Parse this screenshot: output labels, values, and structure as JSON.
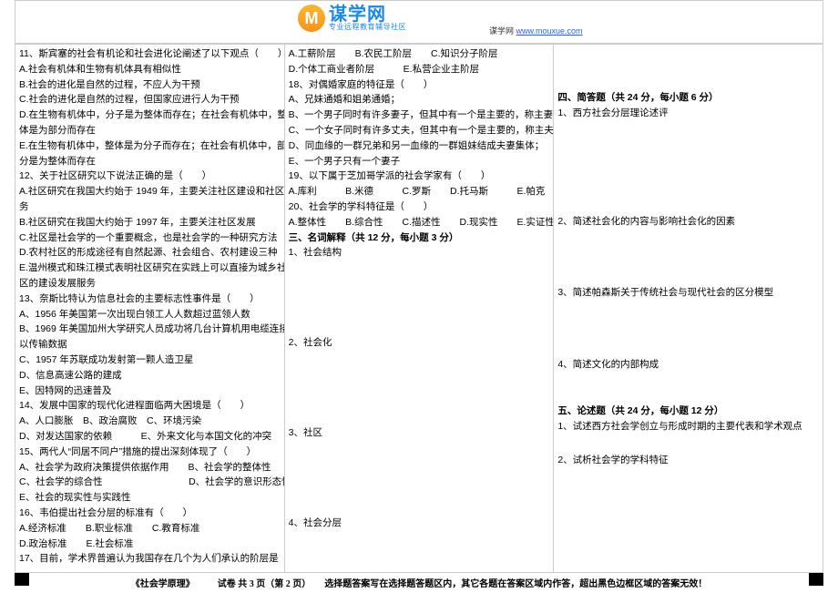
{
  "logo": {
    "main": "谋学网",
    "sub": "专业远程教育辅导社区",
    "mark": "M"
  },
  "site": {
    "pre": "谋学网 ",
    "url": "www.mouxue.com"
  },
  "col1": [
    "11、斯宾塞的社会有机论和社会进化论阐述了以下观点（　　）",
    "A.社会有机体和生物有机体具有相似性",
    "B.社会的进化是自然的过程，不应人为干预",
    "C.社会的进化是自然的过程，但国家应进行人为干预",
    "D.在生物有机体中，分子是为整体而存在；在社会有机体中，整",
    "体是为部分而存在",
    "E.在生物有机体中，整体是为分子而存在；在社会有机体中，部",
    "分是为整体而存在",
    "12、关于社区研究以下说法正确的是（　　）",
    "A.社区研究在我国大约始于 1949 年，主要关注社区建设和社区服",
    "务",
    "B.社区研究在我国大约始于 1997 年，主要关注社区发展",
    "C.社区是社会学的一个重要概念，也是社会学的一种研究方法",
    "D.农村社区的形成途径有自然起源、社会组合、农村建设三种",
    "E.温州模式和珠江模式表明社区研究在实践上可以直接为城乡社",
    "区的建设发展服务",
    "13、奈斯比特认为信息社会的主要标志性事件是（　　）",
    "A、1956 年美国第一次出现白领工人人数超过蓝领人数",
    "B、1969 年美国加州大学研究人员成功将几台计算机用电缆连接",
    "以传输数据",
    "C、1957 年苏联成功发射第一颗人造卫星",
    "D、信息高速公路的建成",
    "E、因特网的迅速普及",
    "14、发展中国家的现代化进程面临两大困境是（　　）",
    "A、人口膨胀　B、政治腐败　C、环境污染",
    "D、对发达国家的依赖　　　E、外来文化与本国文化的冲突",
    "15、两代人“同居不同户”措施的提出深刻体现了（　　）",
    "A、社会学为政府决策提供依据作用　　B、社会学的整体性",
    "C、社会学的综合性　　　　　　　　　D、社会学的意识形态性",
    "E、社会的现实性与实践性",
    "16、韦伯提出社会分层的标准有（　　）",
    "A.经济标准　　B.职业标准　　C.教育标准",
    "D.政治标准　　E.社会标准",
    "17、目前，学术界普遍认为我国存在几个为人们承认的阶层是（　　）"
  ],
  "col2_top": [
    "A.工薪阶层　　B.农民工阶层　　C.知识分子阶层",
    "D.个体工商业者阶层　　　E.私营企业主阶层",
    "18、对偶婚家庭的特征是（　　）",
    "A、兄妹通婚和姐弟通婚；",
    "B、一个男子同时有许多妻子，但其中有一个是主要的，称主妻；",
    "C、一个女子同时有许多丈夫，但其中有一个是主要的，称主夫；",
    "D、同血缘的一群兄弟和另一血缘的一群姐妹结成夫妻集体；",
    "E、一个男子只有一个妻子",
    "19、以下属于芝加哥学派的社会学家有（　　）",
    "A.库利　　　B.米德　　　C.罗斯　　D.托马斯　　　E.帕克",
    "20、社会学的学科特征是（　　）",
    "A.整体性　　B.综合性　　C.描述性　　D.现实性　　E.实证性"
  ],
  "section3_head": "三、名词解释（共 12 分，每小题 3 分）",
  "col2_terms": [
    "1、社会结构",
    "2、社会化",
    "3、社区",
    "4、社会分层"
  ],
  "col3_s4_head": "四、简答题（共 24 分，每小题 6 分）",
  "col3_s4": [
    "1、西方社会分层理论述评",
    "2、简述社会化的内容与影响社会化的因素",
    "3、简述帕森斯关于传统社会与现代社会的区分模型",
    "4、简述文化的内部构成"
  ],
  "col3_s5_head": "五、论述题（共 24 分，每小题 12 分）",
  "col3_s5": [
    "1、试述西方社会学创立与形成时期的主要代表和学术观点",
    "2、试析社会学的学科特征"
  ],
  "footer": "《社会学原理》　　　试卷 共 3 页（第 2 页）　　选择题答案写在选择题答题区内，其它各题在答案区域内作答，超出黑色边框区域的答案无效！"
}
